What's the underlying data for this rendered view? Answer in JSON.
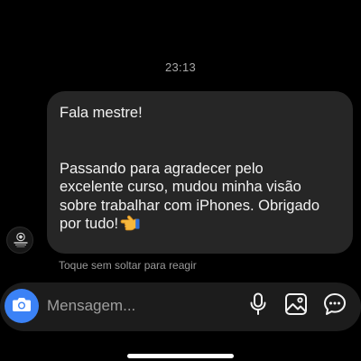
{
  "thread": {
    "timestamp": "23:13"
  },
  "message": {
    "lines": [
      "Fala mestre!",
      "Passando para agradecer pelo",
      "excelente curso, mudou minha visão",
      "sobre trabalhar com iPhones. Obrigado",
      "por tudo!"
    ],
    "emoji": "hand-pointing-left",
    "sender_avatar": "avatar-logo"
  },
  "hint": {
    "text": "Toque sem soltar para reagir"
  },
  "composer": {
    "placeholder": "Mensagem...",
    "icons": [
      "camera-icon",
      "microphone-icon",
      "gallery-icon",
      "sticker-icon"
    ],
    "accent_color": "#3b82f6"
  }
}
